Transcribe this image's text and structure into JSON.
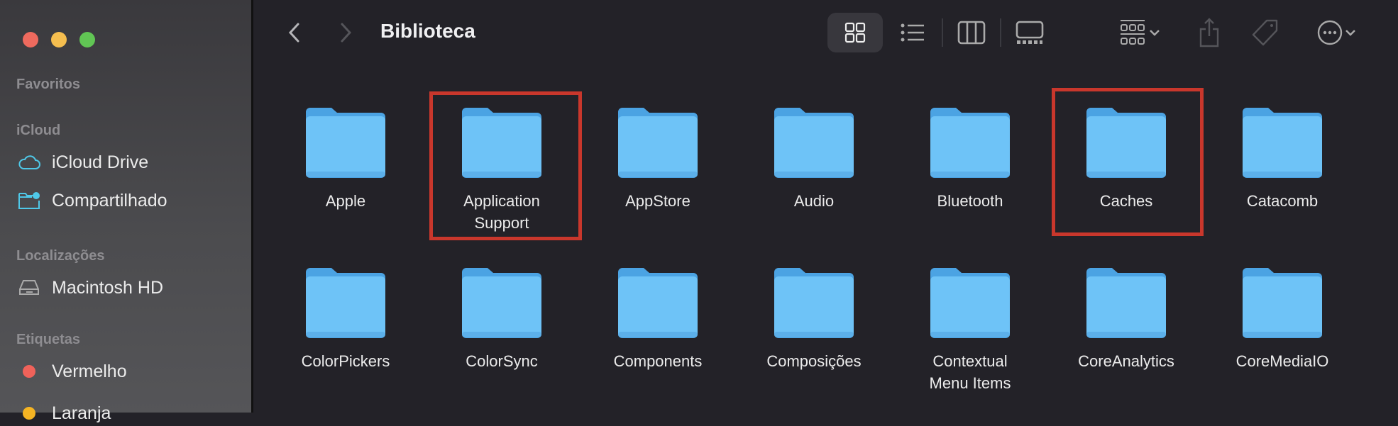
{
  "window": {
    "title": "Biblioteca"
  },
  "sidebar": {
    "sections": [
      {
        "header": "Favoritos",
        "items": []
      },
      {
        "header": "iCloud",
        "items": [
          {
            "label": "iCloud Drive",
            "icon": "cloud-icon"
          },
          {
            "label": "Compartilhado",
            "icon": "shared-folder-icon"
          }
        ]
      },
      {
        "header": "Localizações",
        "items": [
          {
            "label": "Macintosh HD",
            "icon": "hard-drive-icon"
          }
        ]
      },
      {
        "header": "Etiquetas",
        "items": [
          {
            "label": "Vermelho",
            "color": "#f0625a"
          },
          {
            "label": "Laranja",
            "color": "#f5b423"
          }
        ]
      }
    ]
  },
  "toolbar": {
    "icons": [
      "back-icon",
      "forward-icon",
      "icon-view-icon",
      "list-view-icon",
      "column-view-icon",
      "gallery-view-icon",
      "group-icon",
      "share-icon",
      "tag-icon",
      "more-icon"
    ],
    "selected_view": "icons"
  },
  "folders": [
    {
      "name": "Apple"
    },
    {
      "name": "Application Support",
      "highlighted": true
    },
    {
      "name": "AppStore"
    },
    {
      "name": "Audio"
    },
    {
      "name": "Bluetooth"
    },
    {
      "name": "Caches",
      "highlighted": true
    },
    {
      "name": "Catacomb"
    },
    {
      "name": "ColorPickers"
    },
    {
      "name": "ColorSync"
    },
    {
      "name": "Components"
    },
    {
      "name": "Composições"
    },
    {
      "name": "Contextual Menu Items"
    },
    {
      "name": "CoreAnalytics"
    },
    {
      "name": "CoreMediaIO"
    }
  ],
  "colors": {
    "highlight": "#c9372c",
    "folder": "#6ec3f7",
    "accent": "#4fc8e8"
  }
}
